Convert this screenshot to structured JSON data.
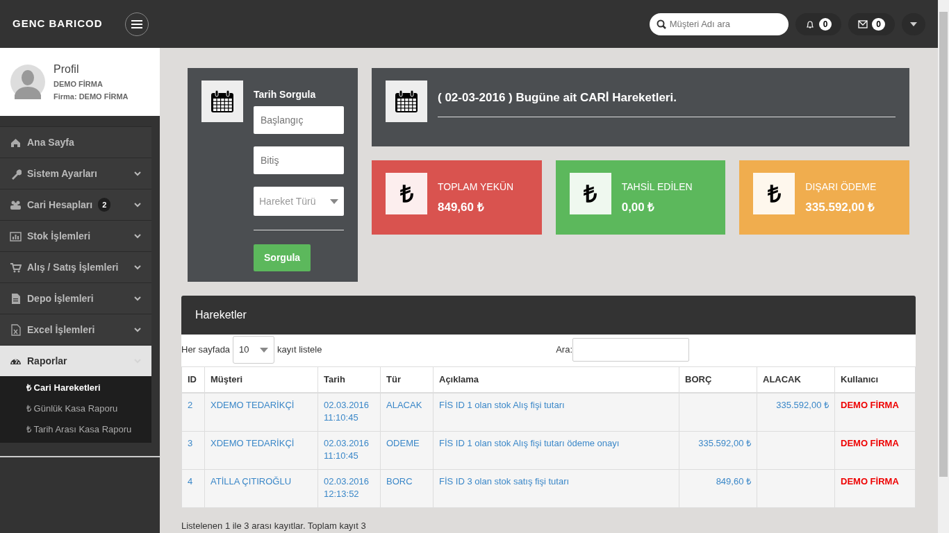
{
  "brand": "GENC BARICOD",
  "profile": {
    "title": "Profil",
    "name": "DEMO FİRMA",
    "company": "Firma: DEMO FİRMA"
  },
  "sidebar": {
    "items": [
      {
        "label": "Ana Sayfa",
        "selected": false
      },
      {
        "label": "Sistem Ayarları",
        "selected": false,
        "expanded": false
      },
      {
        "label": "Cari Hesapları",
        "badge": "2",
        "selected": false,
        "expanded": false
      },
      {
        "label": "Stok İşlemleri",
        "selected": false,
        "expanded": false
      },
      {
        "label": "Alış / Satış İşlemleri",
        "selected": false,
        "expanded": false
      },
      {
        "label": "Depo İşlemleri",
        "selected": false,
        "expanded": false
      },
      {
        "label": "Excel İşlemleri",
        "selected": false,
        "expanded": false
      },
      {
        "label": "Raporlar",
        "selected": true,
        "expanded": true,
        "children": [
          {
            "label": "₺ Cari Hareketleri",
            "selected": true
          },
          {
            "label": "₺ Günlük Kasa Raporu",
            "selected": false
          },
          {
            "label": "₺ Tarih Arası Kasa Raporu",
            "selected": false
          }
        ]
      }
    ]
  },
  "topbar": {
    "search": {
      "placeholder": "Müşteri Adı ara"
    },
    "notifications": "0",
    "messages": "0"
  },
  "query_panel": {
    "title": "Tarih Sorgula",
    "start": {
      "placeholder": "Başlangıç"
    },
    "end": {
      "placeholder": "Bitiş"
    },
    "type": {
      "placeholder": "Hareket Türü"
    },
    "button": "Sorgula"
  },
  "header": {
    "text": "( 02-03-2016 ) Bugüne ait CARİ Hareketleri."
  },
  "stats": [
    {
      "label": "TOPLAM YEKÜN",
      "value": "849,60 ₺",
      "symbol": "₺",
      "color": "#d9534f"
    },
    {
      "label": "TAHSİL EDİLEN",
      "value": "0,00 ₺",
      "symbol": "₺",
      "color": "#5cb85c"
    },
    {
      "label": "DIŞARI ÖDEME",
      "value": "335.592,00 ₺",
      "symbol": "₺",
      "color": "#f0ad4e"
    }
  ],
  "table": {
    "title": "Hareketler",
    "length_label": "Her sayfada",
    "length_value": "10",
    "length_suffix": "kayıt listele",
    "search_label": "Ara:",
    "columns": [
      "ID",
      "Müşteri",
      "Tarih",
      "Tür",
      "Açıklama",
      "BORÇ",
      "ALACAK",
      "Kullanıcı"
    ],
    "rows": [
      [
        "2",
        "XDEMO TEDARİKÇİ",
        "02.03.2016 11:10:45",
        "ALACAK",
        "FİS ID 1 olan stok Alış fişi tutarı",
        "",
        "335.592,00 ₺",
        "DEMO FİRMA"
      ],
      [
        "3",
        "XDEMO TEDARİKÇİ",
        "02.03.2016 11:10:45",
        "ODEME",
        "FİS ID 1 olan stok Alış fişi tutarı ödeme onayı",
        "335.592,00 ₺",
        "",
        "DEMO FİRMA"
      ],
      [
        "4",
        "ATİLLA ÇITIROĞLU",
        "02.03.2016 12:13:52",
        "BORC",
        "FİS ID 3 olan stok satış fişi tutarı",
        "849,60 ₺",
        "",
        "DEMO FİRMA"
      ]
    ],
    "info": "Listelenen 1 ile 3 arası kayıtlar. Toplam kayıt 3"
  }
}
